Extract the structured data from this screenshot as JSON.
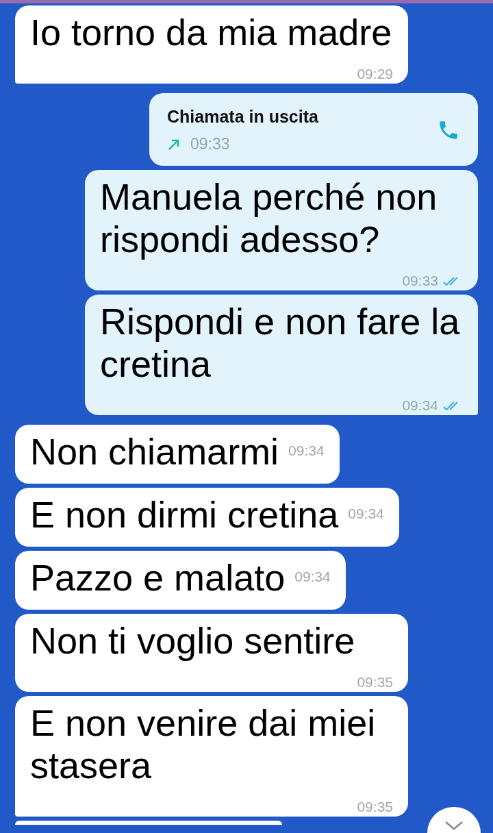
{
  "messages": [
    {
      "kind": "text",
      "outgoing": false,
      "text": "Io torno da mia madre",
      "time": "09:29"
    },
    {
      "kind": "call",
      "outgoing": true,
      "title": "Chiamata in uscita",
      "time": "09:33"
    },
    {
      "kind": "text",
      "outgoing": true,
      "text": "Manuela perché non rispondi adesso?",
      "time": "09:33",
      "read": true
    },
    {
      "kind": "text",
      "outgoing": true,
      "text": "Rispondi e non fare la cretina",
      "time": "09:34",
      "read": true
    },
    {
      "kind": "text",
      "outgoing": false,
      "text": "Non chiamarmi",
      "time": "09:34"
    },
    {
      "kind": "text",
      "outgoing": false,
      "text": "E non dirmi cretina",
      "time": "09:34"
    },
    {
      "kind": "text",
      "outgoing": false,
      "text": "Pazzo e malato",
      "time": "09:34"
    },
    {
      "kind": "text",
      "outgoing": false,
      "text": "Non ti voglio sentire",
      "time": "09:35"
    },
    {
      "kind": "text",
      "outgoing": false,
      "text": "E non venire dai miei stasera",
      "time": "09:35"
    }
  ]
}
